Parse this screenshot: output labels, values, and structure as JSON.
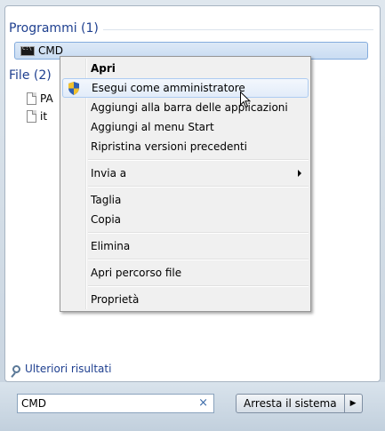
{
  "results": {
    "programs_heading": "Programmi (1)",
    "programs": [
      {
        "label": "CMD",
        "icon": "cmd-icon"
      }
    ],
    "files_heading": "File (2)",
    "files": [
      {
        "label": "PA",
        "icon": "document-icon"
      },
      {
        "label": "it",
        "icon": "document-icon"
      }
    ],
    "more_results": "Ulteriori risultati"
  },
  "context_menu": {
    "items": [
      {
        "label": "Apri"
      },
      {
        "label": "Esegui come amministratore",
        "icon": "uac-shield-icon"
      },
      {
        "label": "Aggiungi alla barra delle applicazioni"
      },
      {
        "label": "Aggiungi al menu Start"
      },
      {
        "label": "Ripristina versioni precedenti"
      },
      {
        "label": "Invia a"
      },
      {
        "label": "Taglia"
      },
      {
        "label": "Copia"
      },
      {
        "label": "Elimina"
      },
      {
        "label": "Apri percorso file"
      },
      {
        "label": "Proprietà"
      }
    ]
  },
  "search": {
    "value": "CMD",
    "clear_symbol": "×"
  },
  "shutdown": {
    "label": "Arresta il sistema",
    "arrow": "▶"
  },
  "colors": {
    "heading": "#1e3f8f",
    "selection_border": "#84acdd",
    "menu_hover_border": "#aeccf1"
  }
}
